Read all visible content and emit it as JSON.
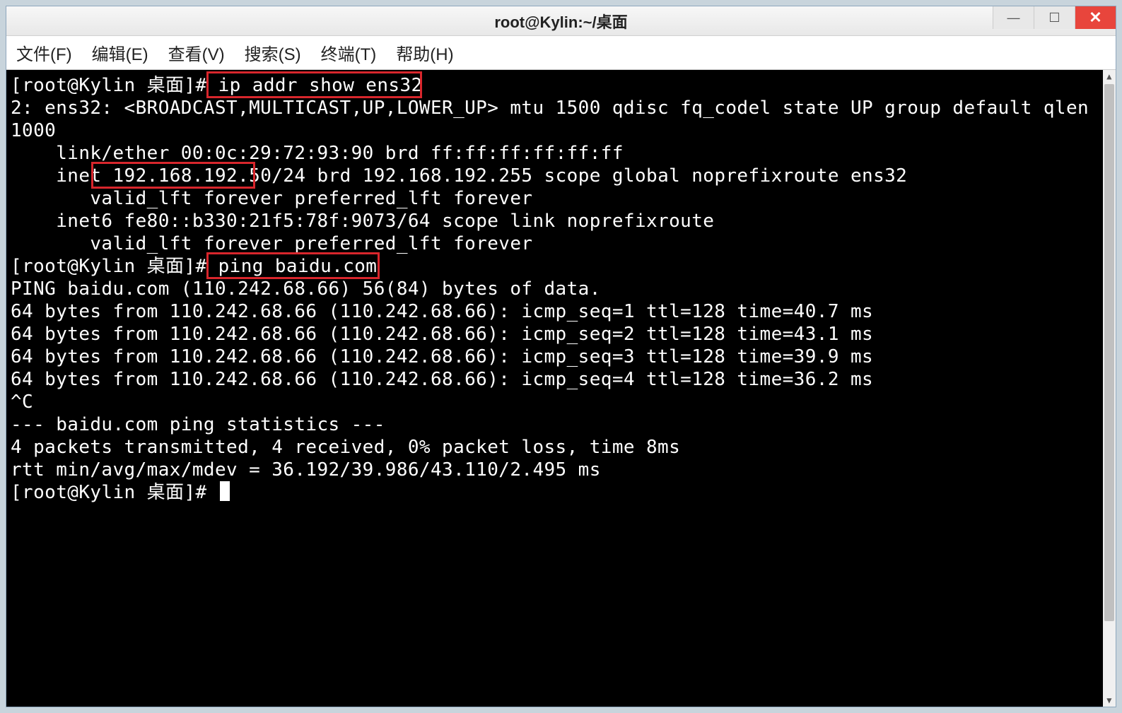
{
  "window": {
    "title": "root@Kylin:~/桌面"
  },
  "menubar": {
    "file": "文件(F)",
    "edit": "编辑(E)",
    "view": "查看(V)",
    "search": "搜索(S)",
    "terminal": "终端(T)",
    "help": "帮助(H)"
  },
  "terminal": {
    "prompt1_pre": "[root@Kylin 桌面]# ",
    "cmd1": "ip addr show ens32",
    "ip_out_1": "2: ens32: <BROADCAST,MULTICAST,UP,LOWER_UP> mtu 1500 qdisc fq_codel state UP group default qlen 1000",
    "ip_out_2": "    link/ether 00:0c:29:72:93:90 brd ff:ff:ff:ff:ff:ff",
    "ip_out_3_pre": "    inet ",
    "ip_addr": "192.168.192.50",
    "ip_out_3_post": "/24 brd 192.168.192.255 scope global noprefixroute ens32",
    "ip_out_4": "       valid_lft forever preferred_lft forever",
    "ip_out_5": "    inet6 fe80::b330:21f5:78f:9073/64 scope link noprefixroute",
    "ip_out_6": "       valid_lft forever preferred_lft forever",
    "prompt2_pre": "[root@Kylin 桌面]# ",
    "cmd2": "ping baidu.com",
    "ping_header": "PING baidu.com (110.242.68.66) 56(84) bytes of data.",
    "ping_1": "64 bytes from 110.242.68.66 (110.242.68.66): icmp_seq=1 ttl=128 time=40.7 ms",
    "ping_2": "64 bytes from 110.242.68.66 (110.242.68.66): icmp_seq=2 ttl=128 time=43.1 ms",
    "ping_3": "64 bytes from 110.242.68.66 (110.242.68.66): icmp_seq=3 ttl=128 time=39.9 ms",
    "ping_4": "64 bytes from 110.242.68.66 (110.242.68.66): icmp_seq=4 ttl=128 time=36.2 ms",
    "ctrl_c": "^C",
    "stats_sep": "--- baidu.com ping statistics ---",
    "stats_1": "4 packets transmitted, 4 received, 0% packet loss, time 8ms",
    "stats_2": "rtt min/avg/max/mdev = 36.192/39.986/43.110/2.495 ms",
    "prompt3": "[root@Kylin 桌面]# "
  },
  "colors": {
    "highlight_border": "#d8262c",
    "terminal_bg": "#000000",
    "terminal_fg": "#ffffff",
    "close_btn": "#e8453c"
  }
}
